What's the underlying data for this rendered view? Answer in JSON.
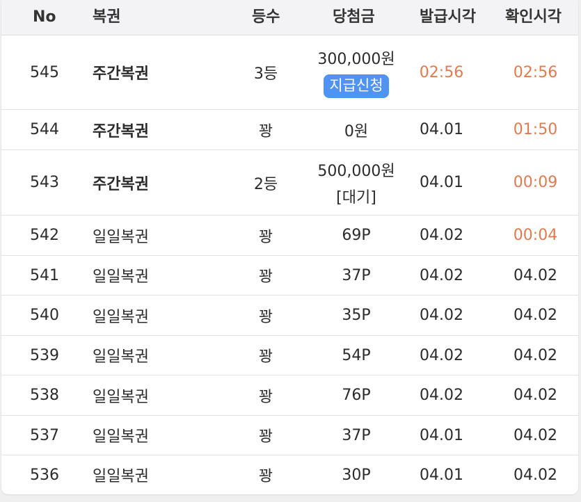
{
  "columns": {
    "no": "No",
    "lottery": "복권",
    "rank": "등수",
    "prize": "당첨금",
    "issue_time": "발급시각",
    "check_time": "확인시각"
  },
  "rows": [
    {
      "no": "545",
      "lottery": "주간복권",
      "rank": "3등",
      "prize": "300,000원",
      "action": "지급신청",
      "issue_time": "02:56",
      "check_time": "02:56"
    },
    {
      "no": "544",
      "lottery": "주간복권",
      "rank": "꽝",
      "prize": "0원",
      "issue_time": "04.01",
      "check_time": "01:50"
    },
    {
      "no": "543",
      "lottery": "주간복권",
      "rank": "2등",
      "prize": "500,000원",
      "prize_status": "[대기]",
      "issue_time": "04.01",
      "check_time": "00:09"
    },
    {
      "no": "542",
      "lottery": "일일복권",
      "rank": "꽝",
      "prize": "69P",
      "issue_time": "04.02",
      "check_time": "00:04"
    },
    {
      "no": "541",
      "lottery": "일일복권",
      "rank": "꽝",
      "prize": "37P",
      "issue_time": "04.02",
      "check_time": "04.02"
    },
    {
      "no": "540",
      "lottery": "일일복권",
      "rank": "꽝",
      "prize": "35P",
      "issue_time": "04.02",
      "check_time": "04.02"
    },
    {
      "no": "539",
      "lottery": "일일복권",
      "rank": "꽝",
      "prize": "54P",
      "issue_time": "04.02",
      "check_time": "04.02"
    },
    {
      "no": "538",
      "lottery": "일일복권",
      "rank": "꽝",
      "prize": "76P",
      "issue_time": "04.02",
      "check_time": "04.02"
    },
    {
      "no": "537",
      "lottery": "일일복권",
      "rank": "꽝",
      "prize": "37P",
      "issue_time": "04.01",
      "check_time": "04.02"
    },
    {
      "no": "536",
      "lottery": "일일복권",
      "rank": "꽝",
      "prize": "30P",
      "issue_time": "04.01",
      "check_time": "04.02"
    }
  ],
  "colors": {
    "accent_time": "#e07b4f",
    "button": "#4f93f5",
    "header_bg": "#f3f3f5"
  }
}
